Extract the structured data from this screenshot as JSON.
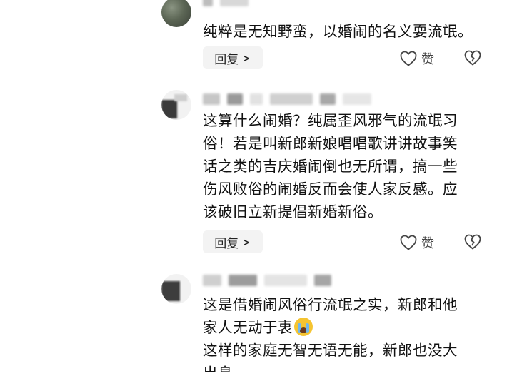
{
  "comments": [
    {
      "text": "纯粹是无知野蛮，以婚闹的名义耍流氓。",
      "reply_label": "回复",
      "like_label": "赞"
    },
    {
      "text": "这算什么闹婚？纯属歪风邪气的流氓习\n俗！若是叫新郎新娘唱唱歌讲讲故事笑\n话之类的吉庆婚闹倒也无所谓，搞一些\n伤风败俗的闹婚反而会使人家反感。应\n该破旧立新提倡新婚新俗。",
      "reply_label": "回复",
      "like_label": "赞"
    },
    {
      "text_line1": "这是借婚闹风俗行流氓之实，新郎和他",
      "text_line2": "家人无动于衷",
      "text_line3": "这样的家庭无智无语无能，新郎也没大",
      "text_line4": "出息"
    }
  ],
  "colors": {
    "text": "#111111",
    "reply_bg": "#f3f3f3",
    "icon": "#444444"
  }
}
